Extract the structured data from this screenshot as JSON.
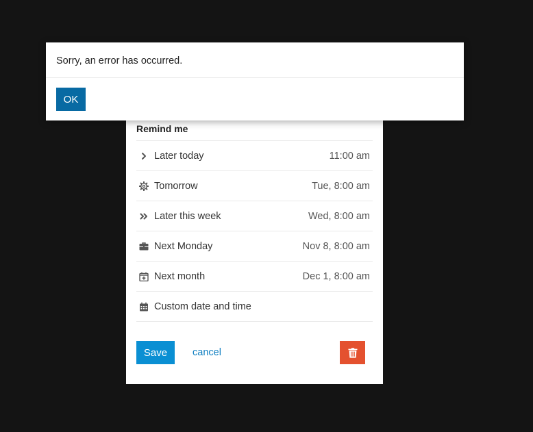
{
  "error_dialog": {
    "message": "Sorry, an error has occurred.",
    "ok_label": "OK"
  },
  "reminder": {
    "title": "Remind me",
    "options": [
      {
        "label": "Later today",
        "time": "11:00 am",
        "icon": "chevron-right-icon"
      },
      {
        "label": "Tomorrow",
        "time": "Tue, 8:00 am",
        "icon": "gear-icon"
      },
      {
        "label": "Later this week",
        "time": "Wed, 8:00 am",
        "icon": "double-chevron-right-icon"
      },
      {
        "label": "Next Monday",
        "time": "Nov 8, 8:00 am",
        "icon": "briefcase-icon"
      },
      {
        "label": "Next month",
        "time": "Dec 1, 8:00 am",
        "icon": "calendar-plus-icon"
      },
      {
        "label": "Custom date and time",
        "time": "",
        "icon": "calendar-icon"
      }
    ],
    "save_label": "Save",
    "cancel_label": "cancel",
    "delete_icon": "trash-icon"
  },
  "colors": {
    "backdrop": "#141414",
    "save_button": "#0a8fd3",
    "ok_button": "#086aa3",
    "delete_button": "#e4512f",
    "cancel_link": "#1180c2"
  }
}
